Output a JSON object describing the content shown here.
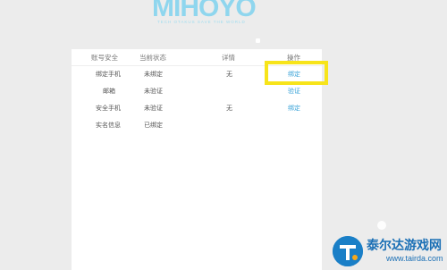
{
  "logo": {
    "text": "MIHOYO",
    "tagline": "TECH OTAKUS SAVE THE WORLD"
  },
  "table": {
    "headers": [
      "账号安全",
      "当前状态",
      "详情",
      "操作"
    ],
    "rows": [
      {
        "item": "绑定手机",
        "status": "未绑定",
        "detail": "无",
        "action": "绑定"
      },
      {
        "item": "邮箱",
        "status": "未验证",
        "detail": "",
        "action": "验证"
      },
      {
        "item": "安全手机",
        "status": "未验证",
        "detail": "无",
        "action": "绑定"
      },
      {
        "item": "实名信息",
        "status": "已绑定",
        "detail": "",
        "action": ""
      }
    ]
  },
  "annotation": {
    "color": "#f7e41a"
  },
  "watermark": {
    "title": "泰尔达游戏网",
    "url": "www.tairda.com"
  }
}
